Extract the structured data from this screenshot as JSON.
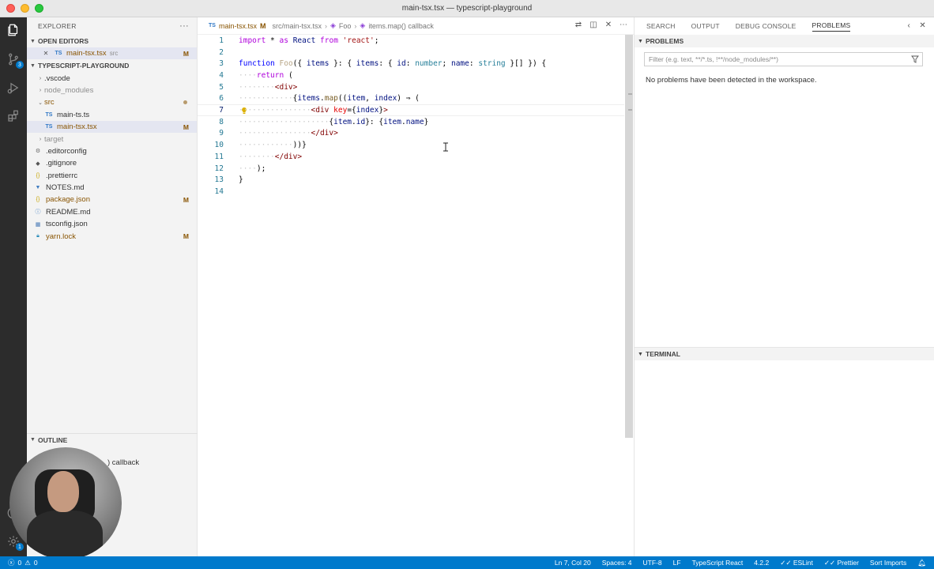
{
  "window": {
    "title": "main-tsx.tsx — typescript-playground"
  },
  "activity": {
    "scm_badge": "3",
    "accounts_badge": "1"
  },
  "sidebar": {
    "title": "EXPLORER",
    "more": "···",
    "open_editors": {
      "label": "OPEN EDITORS",
      "items": [
        {
          "close": "✕",
          "icon": "TS",
          "name": "main-tsx.tsx",
          "dir": "src",
          "status": "M"
        }
      ]
    },
    "project": {
      "label": "TYPESCRIPT-PLAYGROUND",
      "items": [
        {
          "name": ".vscode",
          "kind": "folder",
          "expanded": false
        },
        {
          "name": "node_modules",
          "kind": "folder",
          "expanded": false
        },
        {
          "name": "src",
          "kind": "folder",
          "expanded": true
        },
        {
          "name": "main-ts.ts",
          "kind": "ts",
          "nested": true
        },
        {
          "name": "main-tsx.tsx",
          "kind": "ts",
          "nested": true,
          "status": "M"
        },
        {
          "name": "target",
          "kind": "folder",
          "expanded": false
        },
        {
          "name": ".editorconfig",
          "kind": "cfg"
        },
        {
          "name": ".gitignore",
          "kind": "git"
        },
        {
          "name": ".prettierrc",
          "kind": "json"
        },
        {
          "name": "NOTES.md",
          "kind": "md"
        },
        {
          "name": "package.json",
          "kind": "json",
          "status": "M"
        },
        {
          "name": "README.md",
          "kind": "md"
        },
        {
          "name": "tsconfig.json",
          "kind": "cfgjs"
        },
        {
          "name": "yarn.lock",
          "kind": "yarn",
          "status": "M"
        }
      ]
    },
    "outline": {
      "label": "OUTLINE",
      "item_tail": ") callback"
    }
  },
  "editor": {
    "breadcrumb": {
      "icon": "TS",
      "file": "main-tsx.tsx",
      "status": "M",
      "path": "src/main-tsx.tsx",
      "symbol1": "Foo",
      "symbol2": "items.map() callback"
    },
    "line_numbers": [
      "1",
      "2",
      "3",
      "4",
      "5",
      "6",
      "7",
      "8",
      "9",
      "10",
      "11",
      "12",
      "13",
      "14"
    ],
    "active_line": "7"
  },
  "panel": {
    "tabs": [
      "SEARCH",
      "OUTPUT",
      "DEBUG CONSOLE",
      "PROBLEMS"
    ],
    "active_tab": "PROBLEMS",
    "problems_label": "PROBLEMS",
    "filter_placeholder": "Filter (e.g. text, **/*.ts, !**/node_modules/**)",
    "message": "No problems have been detected in the workspace.",
    "terminal_label": "TERMINAL"
  },
  "status": {
    "errors": "0",
    "warnings": "0",
    "position": "Ln 7, Col 20",
    "spaces": "Spaces: 4",
    "encoding": "UTF-8",
    "eol": "LF",
    "language": "TypeScript React",
    "ts_version": "4.2.2",
    "eslint": "ESLint",
    "prettier": "Prettier",
    "sort_imports": "Sort Imports"
  },
  "colors": {
    "accent": "#007acc",
    "modified": "#895503",
    "sidebar_bg": "#f3f3f3",
    "activity_bg": "#2c2c2c"
  }
}
